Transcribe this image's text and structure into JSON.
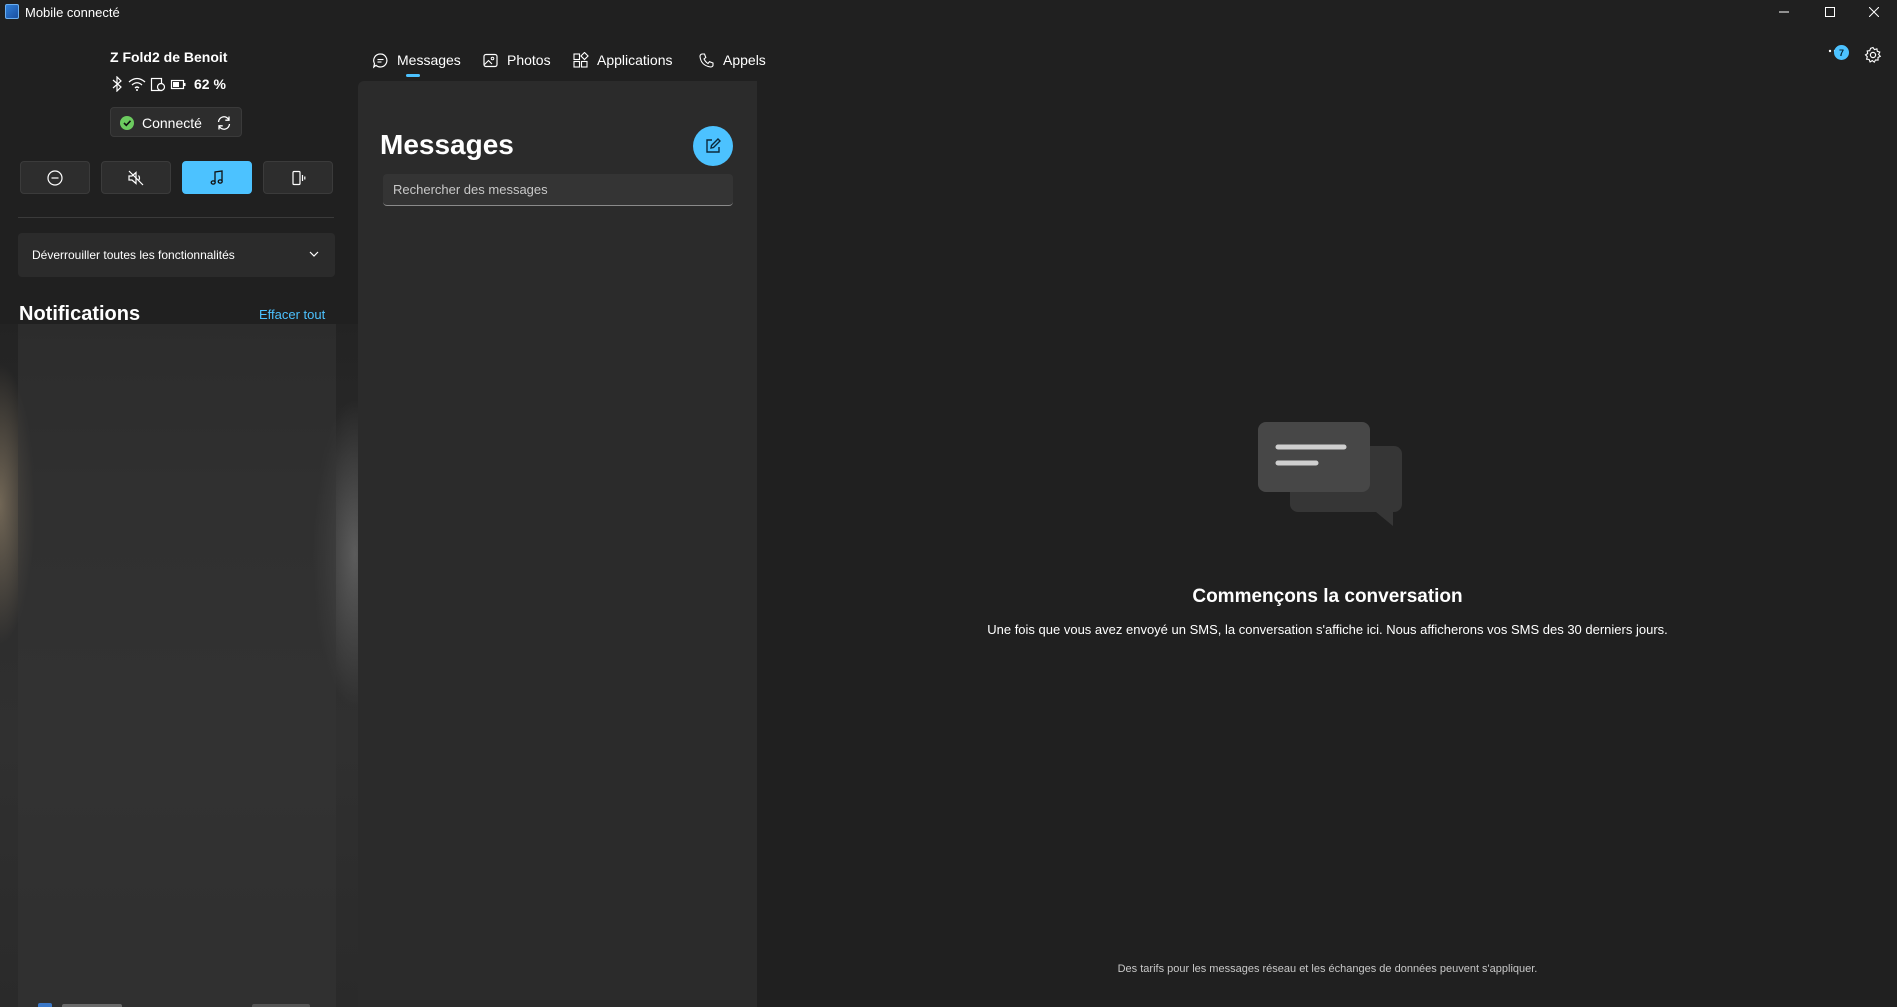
{
  "window": {
    "title": "Mobile connecté"
  },
  "device": {
    "name": "Z Fold2 de Benoit",
    "battery_percent": "62 %",
    "status_label": "Connecté"
  },
  "panel": {
    "unlock_label": "Déverrouiller toutes les fonctionnalités",
    "notifications_title": "Notifications",
    "clear_all_label": "Effacer tout"
  },
  "nav": {
    "tabs": [
      {
        "label": "Messages",
        "active": true
      },
      {
        "label": "Photos",
        "active": false
      },
      {
        "label": "Applications",
        "active": false
      },
      {
        "label": "Appels",
        "active": false
      }
    ],
    "more_badge": "7"
  },
  "messages": {
    "title": "Messages",
    "search_placeholder": "Rechercher des messages"
  },
  "conversation": {
    "empty_title": "Commençons la conversation",
    "empty_subtitle": "Une fois que vous avez envoyé un SMS, la conversation s'affiche ici. Nous afficherons vos SMS des 30 derniers jours.",
    "footer_note": "Des tarifs pour les messages réseau et les échanges de données peuvent s'appliquer."
  },
  "colors": {
    "accent": "#4cc2ff",
    "connected_green": "#6ccb5f",
    "background": "#202020",
    "pane": "#2b2b2b"
  }
}
